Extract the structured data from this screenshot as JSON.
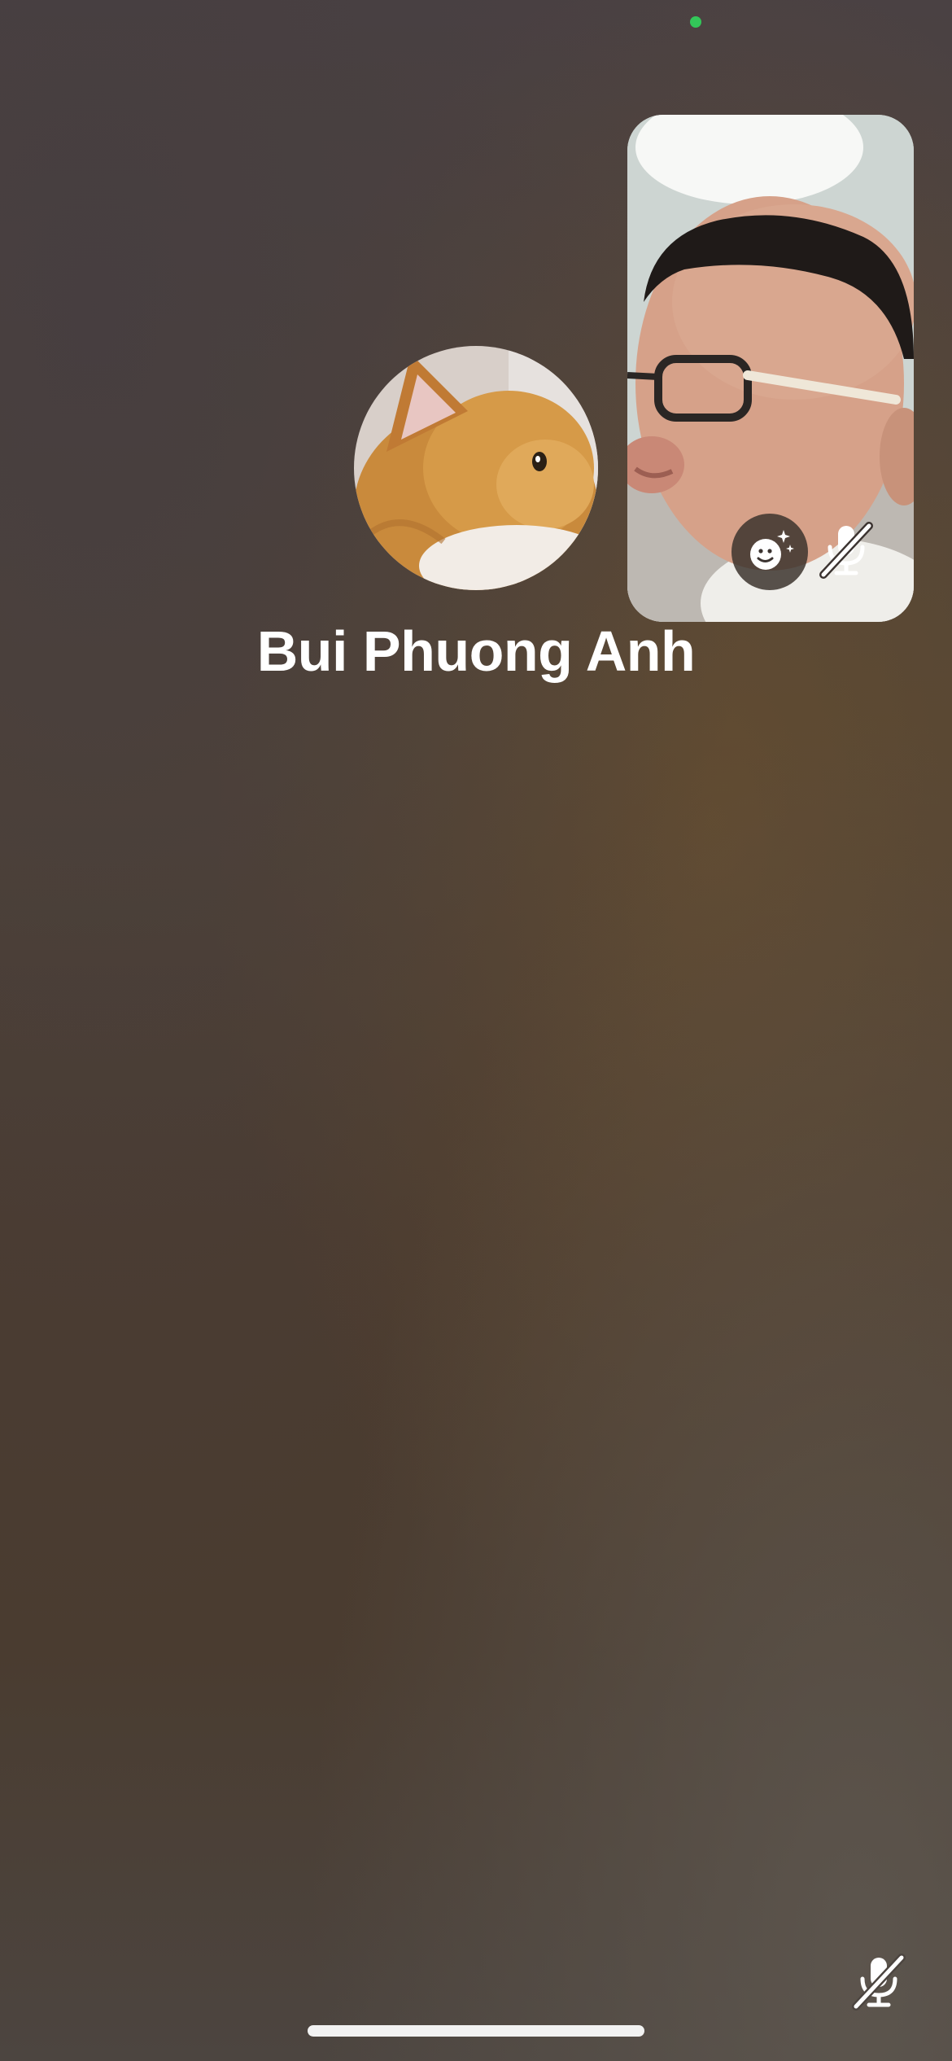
{
  "call": {
    "caller_name": "Bui Phuong Anh",
    "camera_active": true
  },
  "colors": {
    "camera_indicator": "#33c759",
    "text": "#ffffff"
  },
  "icons": {
    "effects": "sparkle-face-icon",
    "self_mic": "microphone-slash-icon",
    "mute": "microphone-slash-icon"
  }
}
